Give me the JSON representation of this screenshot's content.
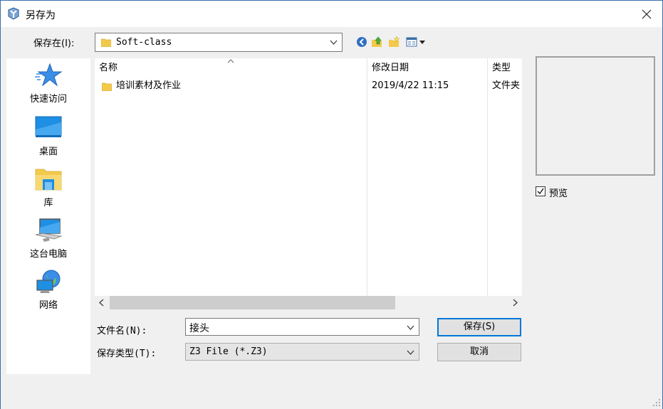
{
  "window": {
    "title": "另存为"
  },
  "savein": {
    "label": "保存在(I):",
    "value": "Soft-class"
  },
  "places": [
    {
      "name": "place-quick-access",
      "label": "快速访问",
      "icon": "star-icon"
    },
    {
      "name": "place-desktop",
      "label": "桌面",
      "icon": "desktop-icon"
    },
    {
      "name": "place-libraries",
      "label": "库",
      "icon": "library-folder-icon"
    },
    {
      "name": "place-this-pc",
      "label": "这台电脑",
      "icon": "computer-icon"
    },
    {
      "name": "place-network",
      "label": "网络",
      "icon": "network-icon"
    }
  ],
  "filelist": {
    "columns": [
      "名称",
      "修改日期",
      "类型"
    ],
    "rows": [
      {
        "name": "培训素材及作业",
        "modified": "2019/4/22 11:15",
        "type": "文件夹"
      }
    ]
  },
  "preview": {
    "label": "预览",
    "checked": true
  },
  "filename": {
    "label": "文件名(N):",
    "value": "接头"
  },
  "filetype": {
    "label": "保存类型(T):",
    "value": "Z3 File (*.Z3)"
  },
  "buttons": {
    "save": "保存(S)",
    "cancel": "取消"
  },
  "colors": {
    "accent": "#0078d7",
    "folder": "#f3c94c"
  }
}
